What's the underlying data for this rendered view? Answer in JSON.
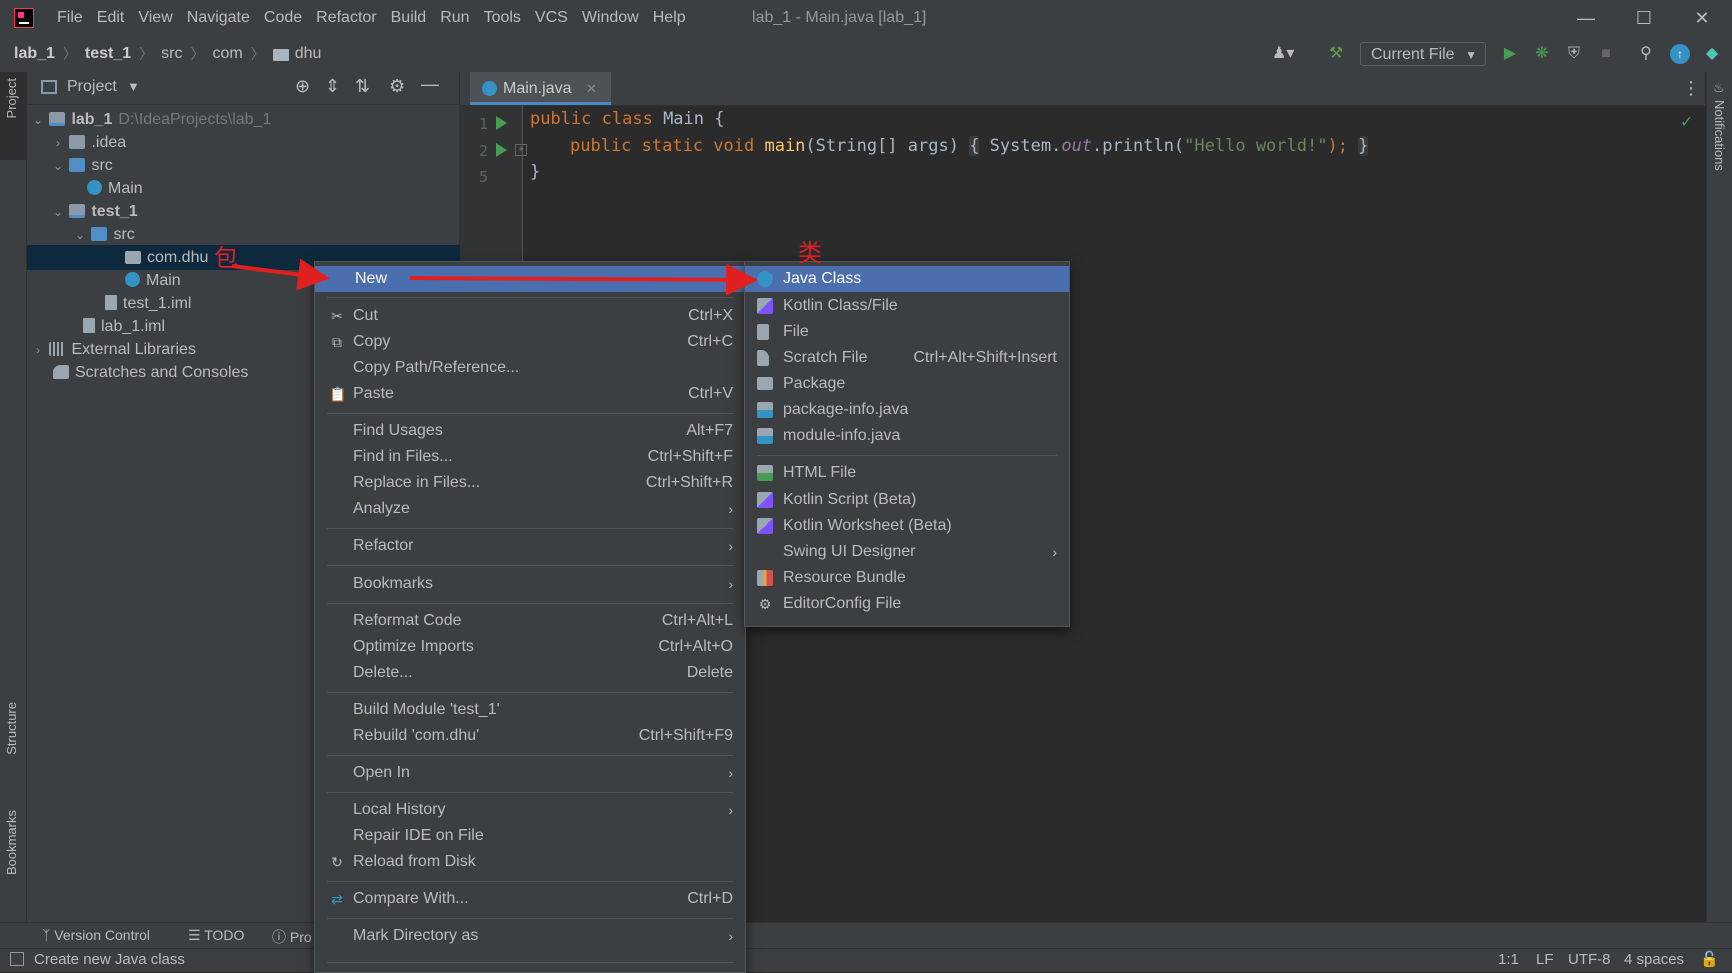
{
  "window": {
    "title": "lab_1 - Main.java [lab_1]"
  },
  "menubar": [
    "File",
    "Edit",
    "View",
    "Navigate",
    "Code",
    "Refactor",
    "Build",
    "Run",
    "Tools",
    "VCS",
    "Window",
    "Help"
  ],
  "breadcrumb": [
    "lab_1",
    "test_1",
    "src",
    "com",
    "dhu"
  ],
  "toolbar": {
    "run_config": "Current File"
  },
  "project": {
    "header": "Project",
    "tree": [
      {
        "label": "lab_1",
        "hint": "D:\\IdeaProjects\\lab_1"
      },
      {
        "label": ".idea"
      },
      {
        "label": "src"
      },
      {
        "label": "Main"
      },
      {
        "label": "test_1"
      },
      {
        "label": "src"
      },
      {
        "label": "com.dhu"
      },
      {
        "label": "Main"
      },
      {
        "label": "test_1.iml"
      },
      {
        "label": "lab_1.iml"
      },
      {
        "label": "External Libraries"
      },
      {
        "label": "Scratches and Consoles"
      }
    ]
  },
  "editor": {
    "tab": "Main.java",
    "line_numbers": [
      "1",
      "2",
      "5"
    ],
    "code": {
      "l1_kw": "public class ",
      "l1_name": "Main {",
      "l2_kw": "public static void ",
      "l2_fn": "main",
      "l2_args": "(String[] args) ",
      "l2_open": "{",
      "l2_sys": " System.",
      "l2_out": "out",
      "l2_print": ".println(",
      "l2_str": "\"Hello world!\"",
      "l2_end": ");",
      "l2_close": "}",
      "l3": "}"
    }
  },
  "context_menu": {
    "items": [
      {
        "label": "New",
        "shortcut": ""
      },
      {
        "label": "Cut",
        "shortcut": "Ctrl+X"
      },
      {
        "label": "Copy",
        "shortcut": "Ctrl+C"
      },
      {
        "label": "Copy Path/Reference...",
        "shortcut": ""
      },
      {
        "label": "Paste",
        "shortcut": "Ctrl+V"
      },
      {
        "label": "Find Usages",
        "shortcut": "Alt+F7"
      },
      {
        "label": "Find in Files...",
        "shortcut": "Ctrl+Shift+F"
      },
      {
        "label": "Replace in Files...",
        "shortcut": "Ctrl+Shift+R"
      },
      {
        "label": "Analyze",
        "shortcut": ""
      },
      {
        "label": "Refactor",
        "shortcut": ""
      },
      {
        "label": "Bookmarks",
        "shortcut": ""
      },
      {
        "label": "Reformat Code",
        "shortcut": "Ctrl+Alt+L"
      },
      {
        "label": "Optimize Imports",
        "shortcut": "Ctrl+Alt+O"
      },
      {
        "label": "Delete...",
        "shortcut": "Delete"
      },
      {
        "label": "Build Module 'test_1'",
        "shortcut": ""
      },
      {
        "label": "Rebuild 'com.dhu'",
        "shortcut": "Ctrl+Shift+F9"
      },
      {
        "label": "Open In",
        "shortcut": ""
      },
      {
        "label": "Local History",
        "shortcut": ""
      },
      {
        "label": "Repair IDE on File",
        "shortcut": ""
      },
      {
        "label": "Reload from Disk",
        "shortcut": ""
      },
      {
        "label": "Compare With...",
        "shortcut": "Ctrl+D"
      },
      {
        "label": "Mark Directory as",
        "shortcut": ""
      }
    ]
  },
  "submenu": {
    "items": [
      {
        "label": "Java Class",
        "shortcut": ""
      },
      {
        "label": "Kotlin Class/File",
        "shortcut": ""
      },
      {
        "label": "File",
        "shortcut": ""
      },
      {
        "label": "Scratch File",
        "shortcut": "Ctrl+Alt+Shift+Insert"
      },
      {
        "label": "Package",
        "shortcut": ""
      },
      {
        "label": "package-info.java",
        "shortcut": ""
      },
      {
        "label": "module-info.java",
        "shortcut": ""
      },
      {
        "label": "HTML File",
        "shortcut": ""
      },
      {
        "label": "Kotlin Script (Beta)",
        "shortcut": ""
      },
      {
        "label": "Kotlin Worksheet (Beta)",
        "shortcut": ""
      },
      {
        "label": "Swing UI Designer",
        "shortcut": ""
      },
      {
        "label": "Resource Bundle",
        "shortcut": ""
      },
      {
        "label": "EditorConfig File",
        "shortcut": ""
      }
    ]
  },
  "annotations": {
    "package": "包",
    "class": "类"
  },
  "side_tabs": {
    "project": "Project",
    "structure": "Structure",
    "bookmarks": "Bookmarks",
    "notifications": "Notifications"
  },
  "bottom_tools": [
    "Version Control",
    "TODO",
    "Pro"
  ],
  "status": {
    "message": "Create new Java class",
    "position": "1:1",
    "line_sep": "LF",
    "encoding": "UTF-8",
    "indent": "4 spaces"
  },
  "colors": {
    "highlight": "#4b6eaf",
    "selection": "#0d293e",
    "annotation": "#e02020"
  }
}
